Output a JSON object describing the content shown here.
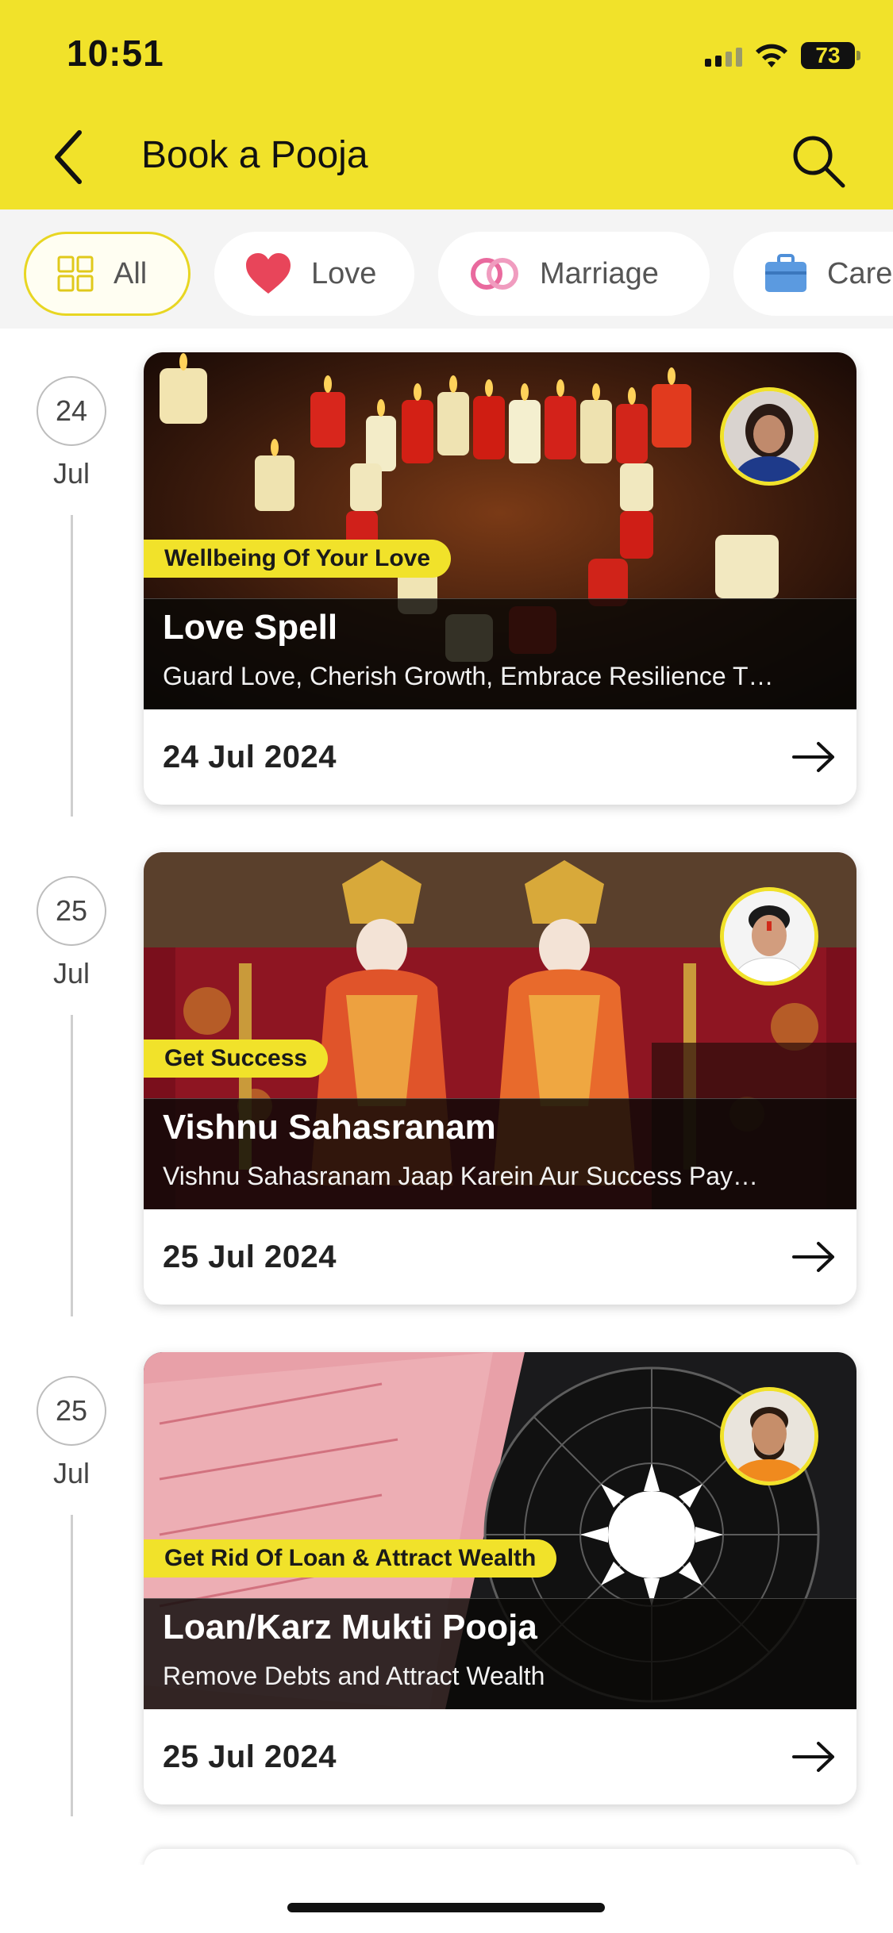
{
  "status_bar": {
    "time": "10:51",
    "battery": "73"
  },
  "header": {
    "title": "Book a Pooja",
    "back_icon": "chevron-left-icon",
    "search_icon": "search-icon"
  },
  "colors": {
    "accent": "#f1e22a",
    "chips_bg": "#f4f4f4",
    "timeline": "#cfcfcf"
  },
  "categories": [
    {
      "label": "All",
      "icon": "grid-icon",
      "selected": true
    },
    {
      "label": "Love",
      "icon": "heart-icon",
      "selected": false
    },
    {
      "label": "Marriage",
      "icon": "rings-icon",
      "selected": false
    },
    {
      "label": "Care",
      "icon": "briefcase-icon",
      "selected": false
    }
  ],
  "poojas": [
    {
      "day": "24",
      "month": "Jul",
      "tag": "Wellbeing Of Your Love",
      "title": "Love Spell",
      "subtitle": "Guard Love, Cherish Growth, Embrace Resilience T…",
      "date": "24 Jul 2024",
      "image_theme": "candles"
    },
    {
      "day": "25",
      "month": "Jul",
      "tag": "Get Success",
      "title": "Vishnu Sahasranam",
      "subtitle": "Vishnu Sahasranam Jaap Karein Aur Success Pay…",
      "date": "25 Jul 2024",
      "image_theme": "deities"
    },
    {
      "day": "25",
      "month": "Jul",
      "tag": "Get Rid Of Loan & Attract Wealth",
      "title": "Loan/Karz Mukti Pooja",
      "subtitle": "Remove Debts and Attract Wealth",
      "date": "25 Jul 2024",
      "image_theme": "money-zodiac"
    }
  ]
}
